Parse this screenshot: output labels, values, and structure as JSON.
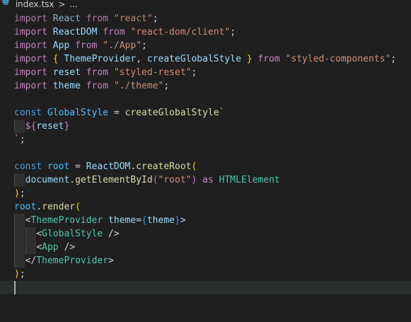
{
  "breadcrumb": {
    "file_name": "index.tsx",
    "separator": ">",
    "more": "...",
    "file_icon": "react-icon",
    "icon_color": "#4fc1ff"
  },
  "colors": {
    "background": "#1f1f1f",
    "keyword": "#c586c0",
    "variable": "#9cdcfe",
    "string": "#ce9178",
    "function": "#dcdcaa",
    "type": "#4ec9b0",
    "constant": "#4fc1ff",
    "tag": "#569cd6"
  },
  "code": {
    "lines": [
      [
        [
          "import",
          "kw"
        ],
        [
          " ",
          ""
        ],
        [
          "React",
          "id"
        ],
        [
          " ",
          ""
        ],
        [
          "from",
          "kw"
        ],
        [
          " ",
          ""
        ],
        [
          "\"react\"",
          "str"
        ],
        [
          ";",
          "punc"
        ]
      ],
      [
        [
          "import",
          "kw"
        ],
        [
          " ",
          ""
        ],
        [
          "ReactDOM",
          "id"
        ],
        [
          " ",
          ""
        ],
        [
          "from",
          "kw"
        ],
        [
          " ",
          ""
        ],
        [
          "\"react-dom/client\"",
          "str"
        ],
        [
          ";",
          "punc"
        ]
      ],
      [
        [
          "import",
          "kw"
        ],
        [
          " ",
          ""
        ],
        [
          "App",
          "id"
        ],
        [
          " ",
          ""
        ],
        [
          "from",
          "kw"
        ],
        [
          " ",
          ""
        ],
        [
          "\"./App\"",
          "str"
        ],
        [
          ";",
          "punc"
        ]
      ],
      [
        [
          "import",
          "kw"
        ],
        [
          " ",
          ""
        ],
        [
          "{",
          "brk1"
        ],
        [
          " ",
          ""
        ],
        [
          "ThemeProvider",
          "id"
        ],
        [
          ", ",
          "punc"
        ],
        [
          "createGlobalStyle",
          "id"
        ],
        [
          " ",
          ""
        ],
        [
          "}",
          "brk1"
        ],
        [
          " ",
          ""
        ],
        [
          "from",
          "kw"
        ],
        [
          " ",
          ""
        ],
        [
          "\"styled-components\"",
          "str"
        ],
        [
          ";",
          "punc"
        ]
      ],
      [
        [
          "import",
          "kw"
        ],
        [
          " ",
          ""
        ],
        [
          "reset",
          "id"
        ],
        [
          " ",
          ""
        ],
        [
          "from",
          "kw"
        ],
        [
          " ",
          ""
        ],
        [
          "\"styled-reset\"",
          "str"
        ],
        [
          ";",
          "punc"
        ]
      ],
      [
        [
          "import",
          "kw"
        ],
        [
          " ",
          ""
        ],
        [
          "theme",
          "id"
        ],
        [
          " ",
          ""
        ],
        [
          "from",
          "kw"
        ],
        [
          " ",
          ""
        ],
        [
          "\"./theme\"",
          "str"
        ],
        [
          ";",
          "punc"
        ]
      ],
      [],
      [
        [
          "const",
          "decl"
        ],
        [
          " ",
          ""
        ],
        [
          "GlobalStyle",
          "const"
        ],
        [
          " = ",
          "punc"
        ],
        [
          "createGlobalStyle",
          "fn"
        ],
        [
          "`",
          "tmpl"
        ]
      ],
      [
        [
          "  ",
          ""
        ],
        [
          "${",
          "kw"
        ],
        [
          "reset",
          "id"
        ],
        [
          "}",
          "kw"
        ]
      ],
      [
        [
          "`",
          "tmpl"
        ],
        [
          ";",
          "punc"
        ]
      ],
      [],
      [
        [
          "const",
          "decl"
        ],
        [
          " ",
          ""
        ],
        [
          "root",
          "const"
        ],
        [
          " = ",
          "punc"
        ],
        [
          "ReactDOM",
          "id"
        ],
        [
          ".",
          "punc"
        ],
        [
          "createRoot",
          "fn"
        ],
        [
          "(",
          "brk1"
        ]
      ],
      [
        [
          "  ",
          ""
        ],
        [
          "document",
          "id"
        ],
        [
          ".",
          "punc"
        ],
        [
          "getElementById",
          "fn"
        ],
        [
          "(",
          "brk2"
        ],
        [
          "\"root\"",
          "str"
        ],
        [
          ")",
          "brk2"
        ],
        [
          " ",
          ""
        ],
        [
          "as",
          "kw"
        ],
        [
          " ",
          ""
        ],
        [
          "HTMLElement",
          "cls"
        ]
      ],
      [
        [
          ")",
          "brk1"
        ],
        [
          ";",
          "punc"
        ]
      ],
      [
        [
          "root",
          "const"
        ],
        [
          ".",
          "punc"
        ],
        [
          "render",
          "fn"
        ],
        [
          "(",
          "brk1"
        ]
      ],
      [
        [
          "  ",
          ""
        ],
        [
          "<",
          "punc"
        ],
        [
          "ThemeProvider",
          "comp"
        ],
        [
          " ",
          ""
        ],
        [
          "theme",
          "attr"
        ],
        [
          "=",
          "punc"
        ],
        [
          "{",
          "brk3"
        ],
        [
          "theme",
          "id"
        ],
        [
          "}",
          "brk3"
        ],
        [
          ">",
          "punc"
        ]
      ],
      [
        [
          "    ",
          ""
        ],
        [
          "<",
          "punc"
        ],
        [
          "GlobalStyle",
          "comp"
        ],
        [
          " />",
          "punc"
        ]
      ],
      [
        [
          "    ",
          ""
        ],
        [
          "<",
          "punc"
        ],
        [
          "App",
          "comp"
        ],
        [
          " />",
          "punc"
        ]
      ],
      [
        [
          "  ",
          ""
        ],
        [
          "</",
          "punc"
        ],
        [
          "ThemeProvider",
          "comp"
        ],
        [
          ">",
          "punc"
        ]
      ],
      [
        [
          ")",
          "brk1"
        ],
        [
          ";",
          "punc"
        ]
      ],
      []
    ]
  }
}
